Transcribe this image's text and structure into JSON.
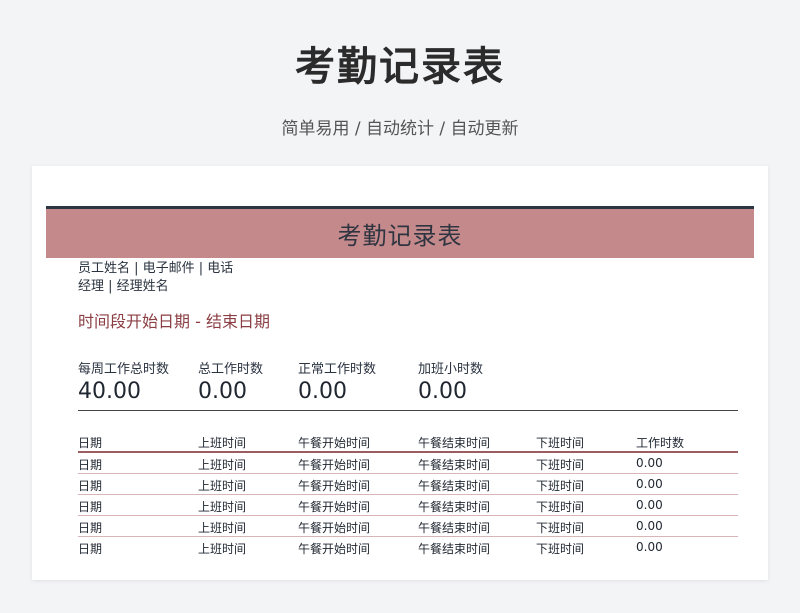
{
  "header": {
    "title": "考勤记录表",
    "subtitle": "简单易用  /  自动统计  /  自动更新"
  },
  "sheet": {
    "title": "考勤记录表",
    "contact_line1": "员工姓名 | 电子邮件 | 电话",
    "contact_line2": "经理 | 经理姓名",
    "period": "时间段开始日期 - 结束日期",
    "stats": [
      {
        "label": "每周工作总时数",
        "value": "40.00"
      },
      {
        "label": "总工作时数",
        "value": "0.00"
      },
      {
        "label": "正常工作时数",
        "value": "0.00"
      },
      {
        "label": "加班小时数",
        "value": "0.00"
      }
    ],
    "table": {
      "columns": [
        "日期",
        "上班时间",
        "午餐开始时间",
        "午餐结束时间",
        "下班时间",
        "工作时数"
      ],
      "rows": [
        [
          "日期",
          "上班时间",
          "午餐开始时间",
          "午餐结束时间",
          "下班时间",
          "0.00"
        ],
        [
          "日期",
          "上班时间",
          "午餐开始时间",
          "午餐结束时间",
          "下班时间",
          "0.00"
        ],
        [
          "日期",
          "上班时间",
          "午餐开始时间",
          "午餐结束时间",
          "下班时间",
          "0.00"
        ],
        [
          "日期",
          "上班时间",
          "午餐开始时间",
          "午餐结束时间",
          "下班时间",
          "0.00"
        ],
        [
          "日期",
          "上班时间",
          "午餐开始时间",
          "午餐结束时间",
          "下班时间",
          "0.00"
        ]
      ]
    }
  },
  "colors": {
    "banner": "#c4898b",
    "banner_top_border": "#2c3540",
    "accent_text": "#8b3e43",
    "background": "#f3f4f6"
  }
}
